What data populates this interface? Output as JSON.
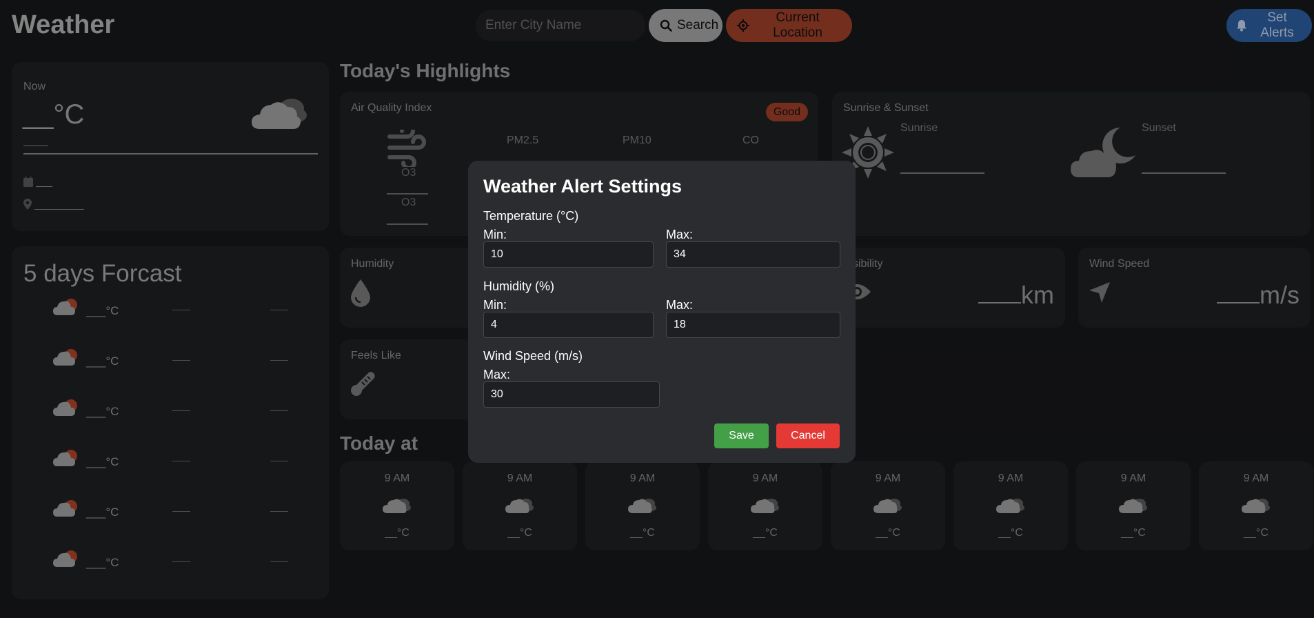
{
  "header": {
    "app_title": "Weather",
    "search_placeholder": "Enter City Name",
    "search_label": "Search",
    "location_label": "Current Location",
    "alerts_label": "Set Alerts"
  },
  "now": {
    "label": "Now",
    "temp": "__°C"
  },
  "forecast": {
    "title": "5 days Forcast",
    "rows": [
      {
        "temp": "___°C"
      },
      {
        "temp": "___°C"
      },
      {
        "temp": "___°C"
      },
      {
        "temp": "___°C"
      },
      {
        "temp": "___°C"
      },
      {
        "temp": "___°C"
      }
    ]
  },
  "highlights": {
    "title": "Today's Highlights",
    "aqi": {
      "label": "Air Quality Index",
      "badge": "Good",
      "columns": [
        "PM2.5",
        "PM10",
        "CO"
      ],
      "o3_label_1": "O3",
      "o3_label_2": "O3"
    },
    "sun": {
      "label": "Sunrise & Sunset",
      "sunrise_label": "Sunrise",
      "sunset_label": "Sunset"
    },
    "humidity": {
      "label": "Humidity"
    },
    "visibility": {
      "label": "Visibility",
      "unit": "km"
    },
    "wind": {
      "label": "Wind Speed",
      "unit": "m/s"
    },
    "feels_like": {
      "label": "Feels Like"
    }
  },
  "today_at": {
    "title": "Today at",
    "hours": [
      {
        "time": "9 AM",
        "temp": "__°C"
      },
      {
        "time": "9 AM",
        "temp": "__°C"
      },
      {
        "time": "9 AM",
        "temp": "__°C"
      },
      {
        "time": "9 AM",
        "temp": "__°C"
      },
      {
        "time": "9 AM",
        "temp": "__°C"
      },
      {
        "time": "9 AM",
        "temp": "__°C"
      },
      {
        "time": "9 AM",
        "temp": "__°C"
      },
      {
        "time": "9 AM",
        "temp": "__°C"
      }
    ]
  },
  "modal": {
    "title": "Weather Alert Settings",
    "temperature_section": "Temperature (°C)",
    "temp_min_label": "Min:",
    "temp_min_value": "10",
    "temp_max_label": "Max:",
    "temp_max_value": "34",
    "humidity_section": "Humidity (%)",
    "hum_min_label": "Min:",
    "hum_min_value": "4",
    "hum_max_label": "Max:",
    "hum_max_value": "18",
    "wind_section": "Wind Speed (m/s)",
    "wind_max_label": "Max:",
    "wind_max_value": "30",
    "save_label": "Save",
    "cancel_label": "Cancel"
  },
  "icons": {
    "search": "search-icon",
    "location": "crosshair-icon",
    "alerts": "bell-icon",
    "weather": "cloud-icon",
    "forecast": "cloud-sun-icon",
    "calendar": "calendar-icon",
    "pin": "location-pin-icon",
    "wind": "wind-icon",
    "sun": "sun-icon",
    "moon": "cloud-moon-icon",
    "humidity": "droplet-icon",
    "visibility": "eye-icon",
    "wind_speed": "navigation-arrow-icon",
    "feels_like": "thermometer-icon"
  },
  "colors": {
    "background": "#17181b",
    "card": "#1f2023",
    "modal": "#2b2c2f",
    "location_btn": "#a0412a",
    "alerts_btn": "#2d5fa0",
    "save_btn": "#43a047",
    "cancel_btn": "#e53935",
    "good_badge": "#a0412a"
  }
}
